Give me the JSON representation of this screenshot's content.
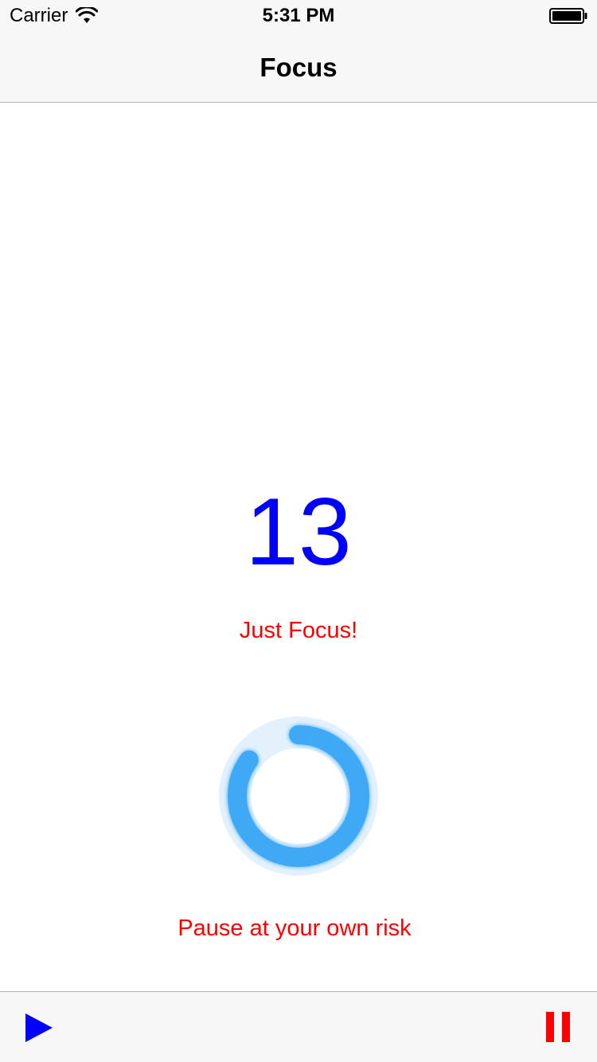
{
  "status_bar": {
    "carrier": "Carrier",
    "time": "5:31 PM",
    "icons": [
      "wifi-icon",
      "battery-icon"
    ]
  },
  "nav": {
    "title": "Focus"
  },
  "main": {
    "counter": "13",
    "message": "Just Focus!",
    "progress": 0.85,
    "warning": "Pause at your own risk"
  },
  "toolbar": {
    "icons": [
      "play-icon",
      "pause-icon"
    ]
  },
  "colors": {
    "counter": "#0000ff",
    "message": "#ff0000",
    "ring": "#3fa9f5",
    "ring_track": "#e3f1fd",
    "play": "#0000ff",
    "pause": "#ff0000"
  }
}
